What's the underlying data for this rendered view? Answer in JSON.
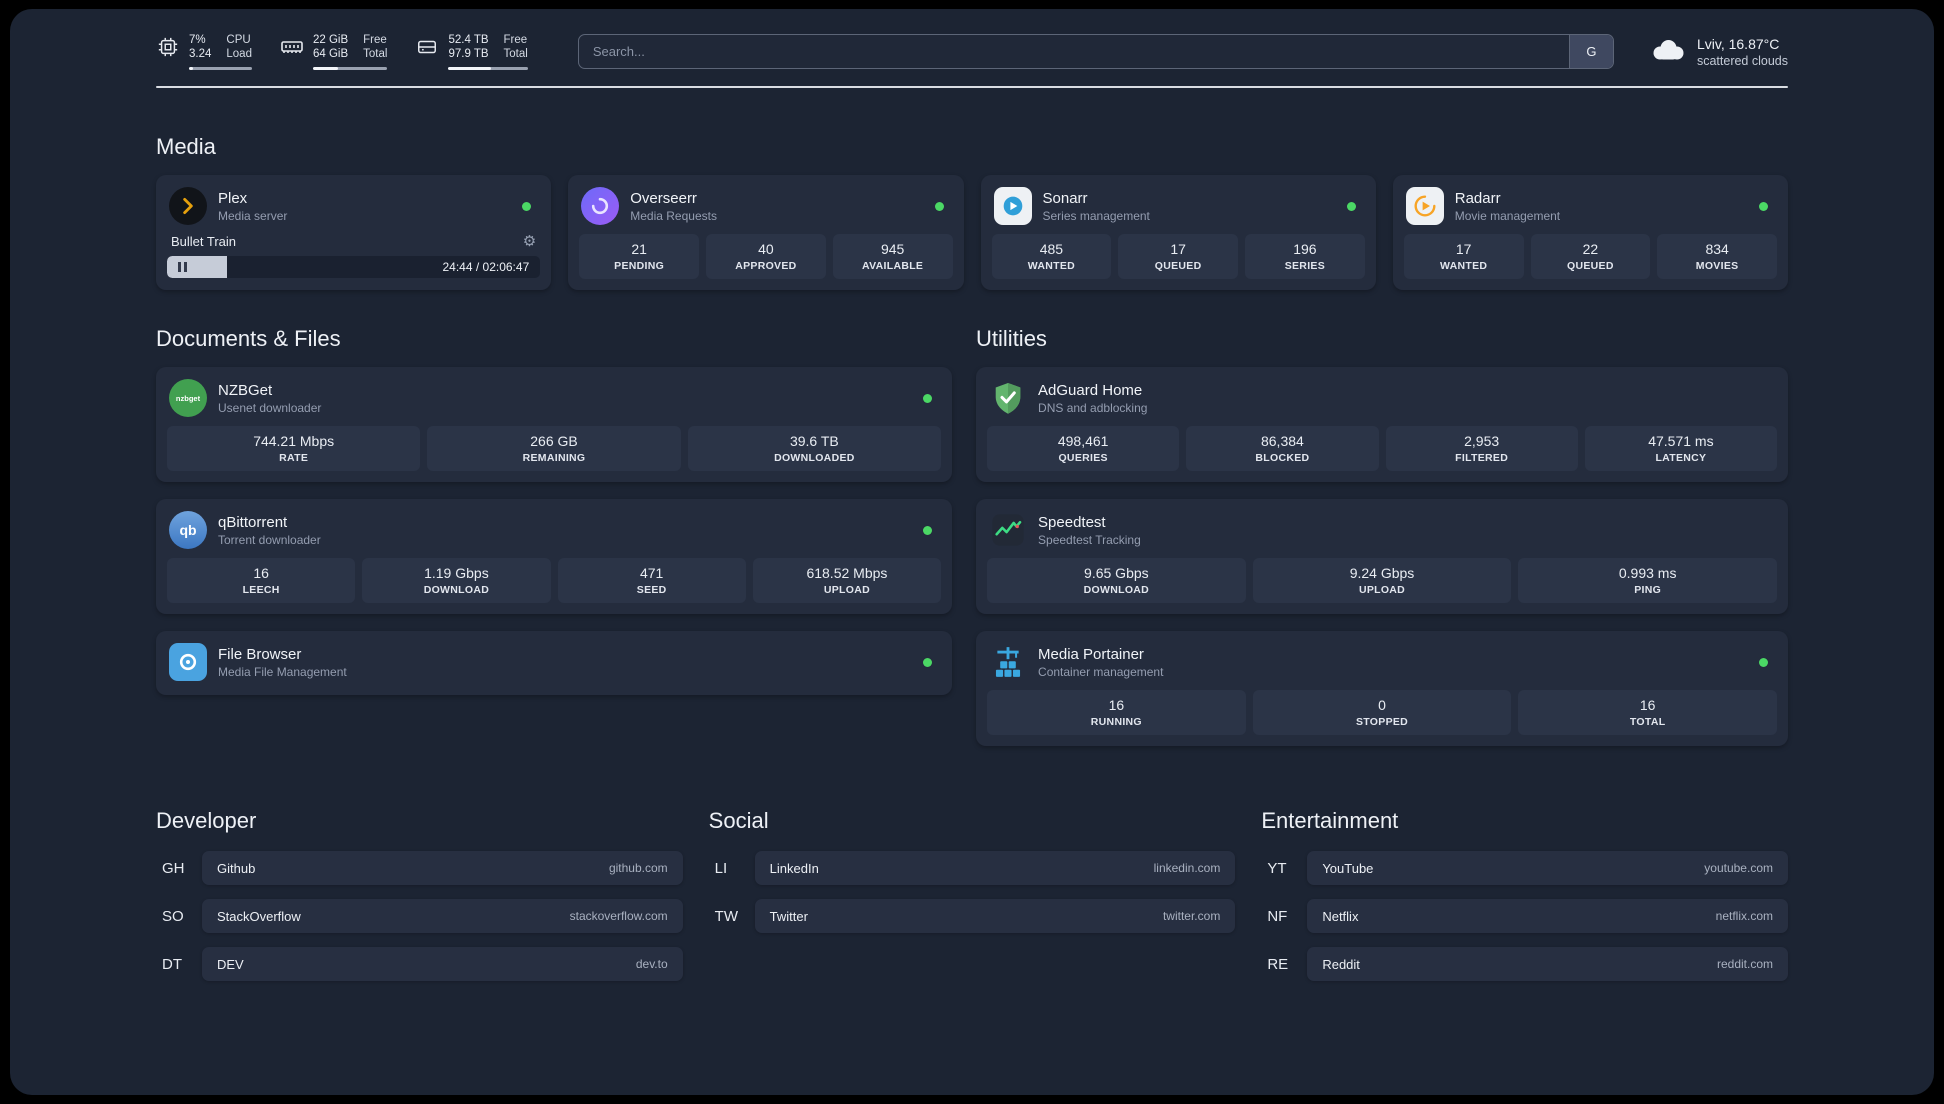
{
  "topbar": {
    "cpu": {
      "value_top": "7%",
      "value_bottom": "3.24",
      "label_top": "CPU",
      "label_bottom": "Load",
      "percent": 7
    },
    "memory": {
      "value_top": "22 GiB",
      "value_bottom": "64 GiB",
      "label_top": "Free",
      "label_bottom": "Total",
      "percent": 34
    },
    "disk": {
      "value_top": "52.4 TB",
      "value_bottom": "97.9 TB",
      "label_top": "Free",
      "label_bottom": "Total",
      "percent": 53
    },
    "search": {
      "placeholder": "Search...",
      "button_label": "G"
    },
    "weather": {
      "location": "Lviv, 16.87°C",
      "condition": "scattered clouds"
    }
  },
  "sections": {
    "media": "Media",
    "documents": "Documents & Files",
    "utilities": "Utilities"
  },
  "services": {
    "plex": {
      "name": "Plex",
      "subtitle": "Media server",
      "status": "online",
      "widget": {
        "track": "Bullet Train",
        "time": "24:44 / 02:06:47",
        "progress_percent": 16
      }
    },
    "overseerr": {
      "name": "Overseerr",
      "subtitle": "Media Requests",
      "status": "online",
      "stats": [
        {
          "value": "21",
          "label": "PENDING"
        },
        {
          "value": "40",
          "label": "APPROVED"
        },
        {
          "value": "945",
          "label": "AVAILABLE"
        }
      ]
    },
    "sonarr": {
      "name": "Sonarr",
      "subtitle": "Series management",
      "status": "online",
      "stats": [
        {
          "value": "485",
          "label": "WANTED"
        },
        {
          "value": "17",
          "label": "QUEUED"
        },
        {
          "value": "196",
          "label": "SERIES"
        }
      ]
    },
    "radarr": {
      "name": "Radarr",
      "subtitle": "Movie management",
      "status": "online",
      "stats": [
        {
          "value": "17",
          "label": "WANTED"
        },
        {
          "value": "22",
          "label": "QUEUED"
        },
        {
          "value": "834",
          "label": "MOVIES"
        }
      ]
    },
    "nzbget": {
      "name": "NZBGet",
      "subtitle": "Usenet downloader",
      "status": "online",
      "stats": [
        {
          "value": "744.21 Mbps",
          "label": "RATE"
        },
        {
          "value": "266 GB",
          "label": "REMAINING"
        },
        {
          "value": "39.6 TB",
          "label": "DOWNLOADED"
        }
      ]
    },
    "qbittorrent": {
      "name": "qBittorrent",
      "subtitle": "Torrent downloader",
      "status": "online",
      "stats": [
        {
          "value": "16",
          "label": "LEECH"
        },
        {
          "value": "1.19 Gbps",
          "label": "DOWNLOAD"
        },
        {
          "value": "471",
          "label": "SEED"
        },
        {
          "value": "618.52 Mbps",
          "label": "UPLOAD"
        }
      ]
    },
    "filebrowser": {
      "name": "File Browser",
      "subtitle": "Media File Management",
      "status": "online"
    },
    "adguard": {
      "name": "AdGuard Home",
      "subtitle": "DNS and adblocking",
      "stats": [
        {
          "value": "498,461",
          "label": "QUERIES"
        },
        {
          "value": "86,384",
          "label": "BLOCKED"
        },
        {
          "value": "2,953",
          "label": "FILTERED"
        },
        {
          "value": "47.571 ms",
          "label": "LATENCY"
        }
      ]
    },
    "speedtest": {
      "name": "Speedtest",
      "subtitle": "Speedtest Tracking",
      "stats": [
        {
          "value": "9.65 Gbps",
          "label": "DOWNLOAD"
        },
        {
          "value": "9.24 Gbps",
          "label": "UPLOAD"
        },
        {
          "value": "0.993 ms",
          "label": "PING"
        }
      ]
    },
    "portainer": {
      "name": "Media Portainer",
      "subtitle": "Container management",
      "status": "online",
      "stats": [
        {
          "value": "16",
          "label": "RUNNING"
        },
        {
          "value": "0",
          "label": "STOPPED"
        },
        {
          "value": "16",
          "label": "TOTAL"
        }
      ]
    }
  },
  "bookmarks": {
    "developer": {
      "title": "Developer",
      "items": [
        {
          "abbr": "GH",
          "name": "Github",
          "url": "github.com"
        },
        {
          "abbr": "SO",
          "name": "StackOverflow",
          "url": "stackoverflow.com"
        },
        {
          "abbr": "DT",
          "name": "DEV",
          "url": "dev.to"
        }
      ]
    },
    "social": {
      "title": "Social",
      "items": [
        {
          "abbr": "LI",
          "name": "LinkedIn",
          "url": "linkedin.com"
        },
        {
          "abbr": "TW",
          "name": "Twitter",
          "url": "twitter.com"
        }
      ]
    },
    "entertainment": {
      "title": "Entertainment",
      "items": [
        {
          "abbr": "YT",
          "name": "YouTube",
          "url": "youtube.com"
        },
        {
          "abbr": "NF",
          "name": "Netflix",
          "url": "netflix.com"
        },
        {
          "abbr": "RE",
          "name": "Reddit",
          "url": "reddit.com"
        }
      ]
    }
  },
  "colors": {
    "status_online": "#4bd865",
    "plex": "#e5a00d",
    "overseerr": "#7b5bd6",
    "sonarr": "#2f9fd8",
    "radarr": "#f7a426",
    "nzbget": "#41a050",
    "qbittorrent": "#3c77c2",
    "filebrowser": "#4aa3e0",
    "adguard": "#63b56e",
    "speedtest": "#3ddc84",
    "portainer": "#3aa8e0"
  }
}
